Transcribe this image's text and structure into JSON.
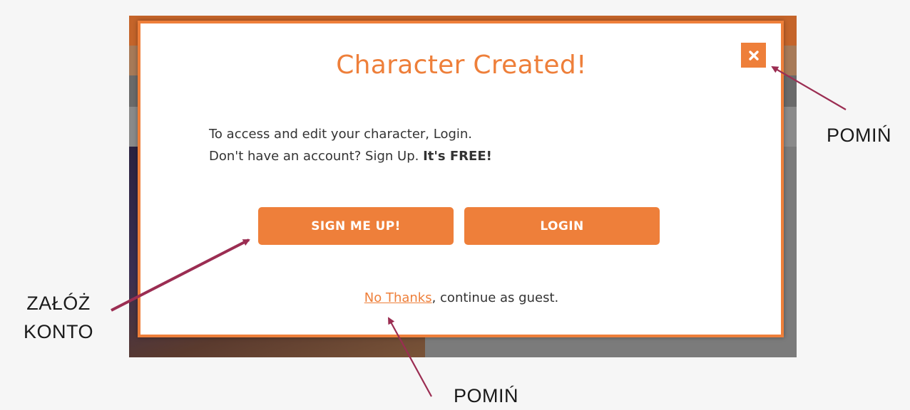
{
  "modal": {
    "title": "Character Created!",
    "line1": "To access and edit your character, Login.",
    "line2_prefix": "Don't have an account? Sign Up. ",
    "line2_bold": "It's FREE!",
    "signup_label": "SIGN ME UP!",
    "login_label": "LOGIN",
    "no_thanks_label": "No Thanks",
    "guest_suffix": ", continue as guest.",
    "close_icon": "close-icon"
  },
  "annotations": {
    "close_label": "POMIŃ",
    "signup_label_line1": "ZAŁÓŻ",
    "signup_label_line2": "KONTO",
    "guest_label": "POMIŃ"
  },
  "colors": {
    "accent": "#ee7f3a",
    "arrow": "#9b2d52",
    "text": "#333333"
  }
}
